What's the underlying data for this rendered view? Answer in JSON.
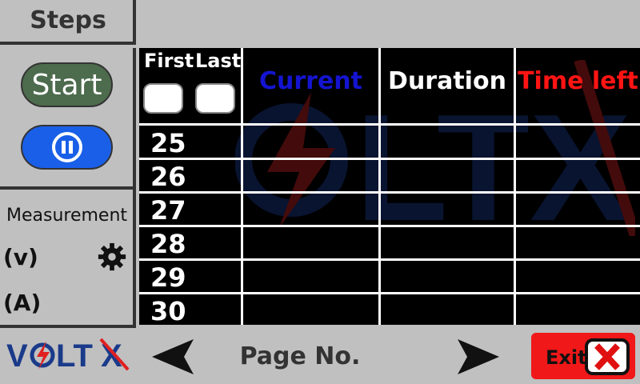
{
  "header": {
    "steps_title": "Steps"
  },
  "controls": {
    "start_label": "Start",
    "pause_icon": "pause-icon",
    "settings_icon": "gear-icon"
  },
  "measurement": {
    "label": "Measurement",
    "voltage_unit": "(v)",
    "current_unit": "(A)"
  },
  "logo": {
    "text": "VOLTX"
  },
  "table": {
    "first_label": "First",
    "last_label": "Last",
    "first_value": "",
    "last_value": "",
    "columns": [
      {
        "label": "Current",
        "color": "#1414d0"
      },
      {
        "label": "Duration",
        "color": "#ffffff"
      },
      {
        "label": "Time left",
        "color": "#ff1414"
      }
    ],
    "rows": [
      "25",
      "26",
      "27",
      "28",
      "29",
      "30"
    ]
  },
  "footer": {
    "page_label": "Page No.",
    "exit_label": "Exit"
  },
  "colors": {
    "start_button": "#4d6b4d",
    "pause_button": "#1a5fe8",
    "exit_button": "#f01818",
    "background": "#c0c0c0"
  }
}
